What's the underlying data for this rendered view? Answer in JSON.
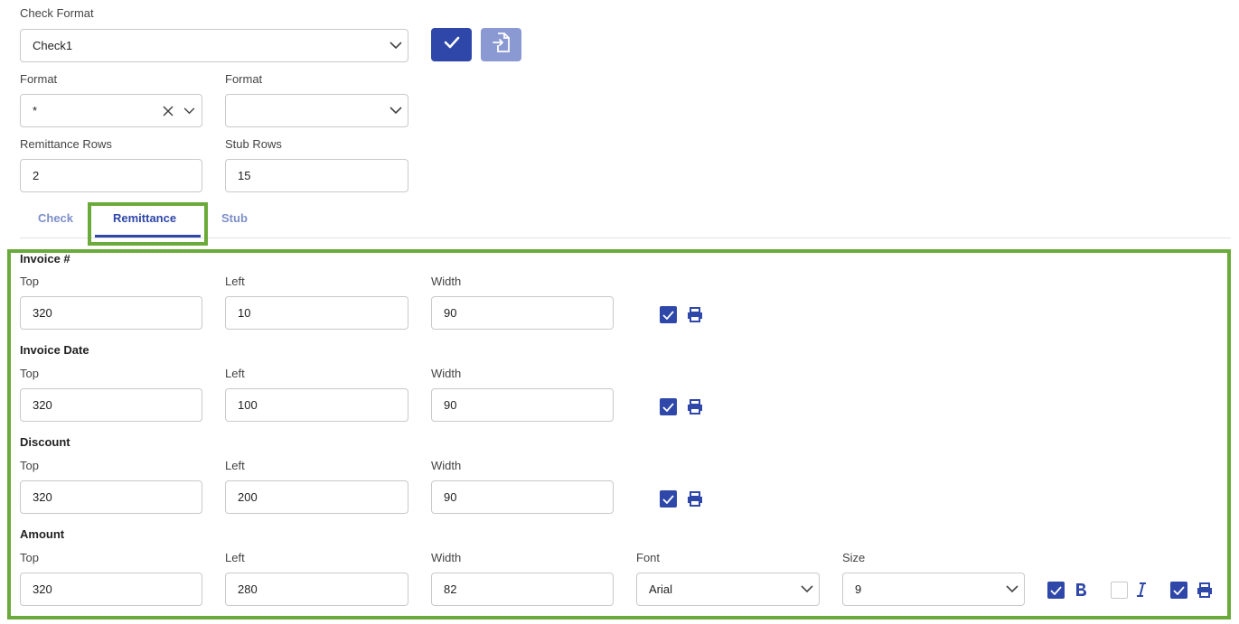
{
  "header": {
    "check_format_label": "Check Format",
    "check_format_value": "Check1",
    "format1_label": "Format",
    "format1_value": "*",
    "format2_label": "Format",
    "format2_value": "",
    "remittance_rows_label": "Remittance Rows",
    "remittance_rows_value": "2",
    "stub_rows_label": "Stub Rows",
    "stub_rows_value": "15"
  },
  "tabs": [
    {
      "label": "Check",
      "active": false
    },
    {
      "label": "Remittance",
      "active": true
    },
    {
      "label": "Stub",
      "active": false
    }
  ],
  "labels": {
    "top": "Top",
    "left": "Left",
    "width": "Width",
    "font": "Font",
    "size": "Size"
  },
  "fields": [
    {
      "name": "Invoice #",
      "top": "320",
      "left": "10",
      "width": "90",
      "print": true
    },
    {
      "name": "Invoice Date",
      "top": "320",
      "left": "100",
      "width": "90",
      "print": true
    },
    {
      "name": "Discount",
      "top": "320",
      "left": "200",
      "width": "90",
      "print": true
    },
    {
      "name": "Amount",
      "top": "320",
      "left": "280",
      "width": "82",
      "font": "Arial",
      "size": "9",
      "bold": true,
      "italic": false,
      "print": true
    }
  ],
  "icons": {
    "confirm": "check-icon",
    "import": "file-import-icon",
    "print": "printer-icon",
    "bold": "bold-icon",
    "italic": "italic-icon"
  },
  "colors": {
    "primary": "#2e47a8",
    "primary_disabled": "#8b99d2",
    "highlight": "#6aaa3a",
    "tab_inactive": "#7d8fc9"
  }
}
